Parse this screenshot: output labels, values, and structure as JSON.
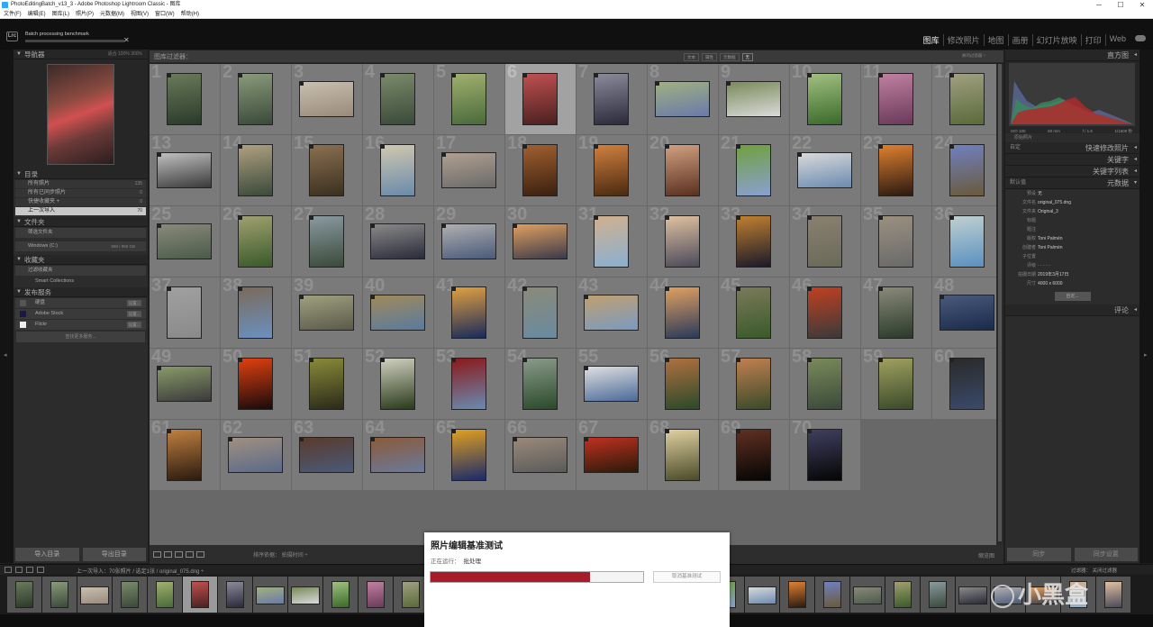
{
  "window": {
    "title": "PhotoEditingBatch_v13_3 - Adobe Photoshop Lightroom Classic - 图库",
    "min": "─",
    "max": "☐",
    "close": "✕"
  },
  "menu": [
    "文件(F)",
    "编辑(E)",
    "图库(L)",
    "照片(P)",
    "元数据(M)",
    "视图(V)",
    "窗口(W)",
    "帮助(H)"
  ],
  "topbar": {
    "logo": "Lrc",
    "progress_title": "Batch processing benchmark",
    "progress_close": "✕",
    "modules": [
      "图库",
      "修改照片",
      "地图",
      "画册",
      "幻灯片放映",
      "打印",
      "Web"
    ],
    "active_module": "图库"
  },
  "left": {
    "navigator": {
      "label": "导航器",
      "zoom": "适合   100%   300%"
    },
    "catalog": {
      "label": "目录",
      "rows": [
        {
          "label": "所有照片",
          "count": "135"
        },
        {
          "label": "所有已同步照片",
          "count": "0"
        },
        {
          "label": "快捷收藏夹 +",
          "count": "0"
        },
        {
          "label": "上一次导入",
          "count": "70"
        }
      ]
    },
    "folders": {
      "label": "文件夹",
      "filter": "筛选文件夹",
      "volume": "Windows (C:)",
      "volume_info": "590 / 950 GB"
    },
    "collections": {
      "label": "收藏夹",
      "filter": "过滤收藏夹",
      "smart": "Smart Collections"
    },
    "publish": {
      "label": "发布服务",
      "services": [
        {
          "name": "硬盘",
          "btn": "设置..."
        },
        {
          "name": "Adobe Stock",
          "btn": "设置..."
        },
        {
          "name": "Flickr",
          "btn": "设置..."
        }
      ],
      "find_more": "查找更多服务..."
    },
    "import_btn": "导入目录",
    "export_btn": "导出目录"
  },
  "filter": {
    "label": "图库过滤器：",
    "tabs": [
      "文本",
      "属性",
      "元数据",
      "无"
    ],
    "active": "无",
    "right": "关闭过滤器 ÷"
  },
  "grid": {
    "selected": 6
  },
  "toolbar": {
    "sort_label": "排序依据：",
    "sort_value": "拍摄时间 ÷",
    "thumb_label": "缩览图"
  },
  "right": {
    "histogram": {
      "label": "直方图",
      "iso": "ISO 100",
      "focal": "60 mm",
      "aperture": "f / 1.6",
      "shutter": "1/1600 秒",
      "original": "原始照片"
    },
    "quick_develop": {
      "label": "快速修改照片",
      "preset": "自定"
    },
    "keywording": "关键字",
    "keyword_list": "关键字列表",
    "metadata": {
      "label": "元数据",
      "preset": "默认值",
      "rows": [
        {
          "k": "预设",
          "v": "无"
        },
        {
          "k": "文件名",
          "v": "original_075.dng"
        },
        {
          "k": "文件夹",
          "v": "Original_3"
        },
        {
          "k": "标题",
          "v": ""
        },
        {
          "k": "题注",
          "v": ""
        },
        {
          "k": "版权",
          "v": "Toni Palmén"
        },
        {
          "k": "创建者",
          "v": "Toni Palmén"
        },
        {
          "k": "子位置",
          "v": ""
        },
        {
          "k": "评级",
          "v": "· · · · ·"
        },
        {
          "k": "拍摄日期",
          "v": "2019年3月17日"
        },
        {
          "k": "尺寸",
          "v": "4000 x 6000"
        }
      ],
      "custom": "自定..."
    },
    "comments": "评论",
    "sync_btn": "同步",
    "sync_settings_btn": "同步设置"
  },
  "filmbar": {
    "info": "上一次导入：70张照片 / 选定1张 / original_075.dng ÷",
    "filter_label": "过滤器：",
    "filter_value": "关闭过滤器"
  },
  "dialog": {
    "title": "照片编辑基准测试",
    "status_label": "正在运行：",
    "status_value": "批处理",
    "progress": 0.75,
    "cancel": "取消基准测试"
  },
  "watermark": "小黑盒",
  "colors": {
    "accent": "#a71c2a",
    "selected": "#a2a2a2",
    "cell": "#7a7a7a"
  }
}
